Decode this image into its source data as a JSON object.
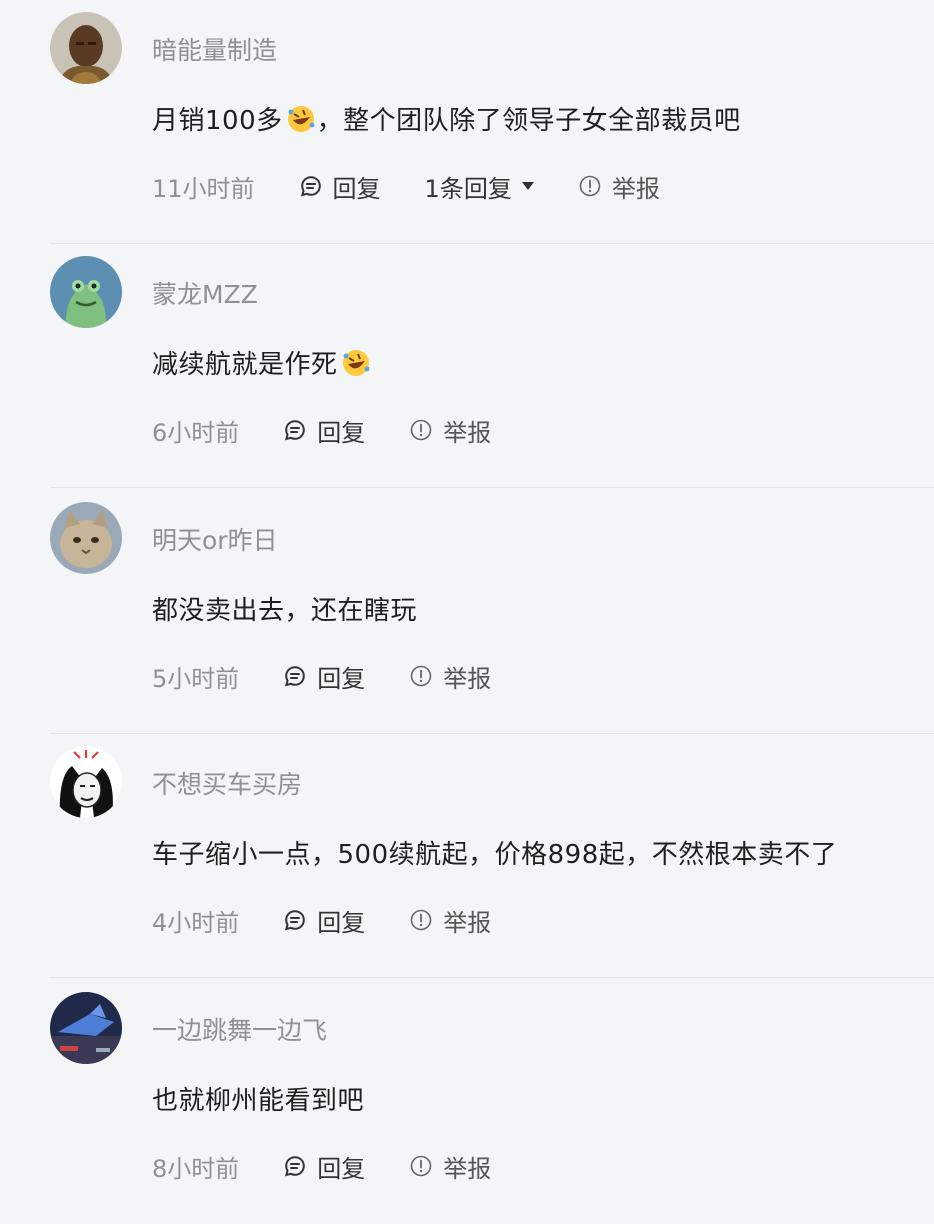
{
  "comments": [
    {
      "username": "暗能量制造",
      "content": "月销100多",
      "content_tail": "，整个团队除了领导子女全部裁员吧",
      "emoji": "rofl-emoji",
      "time": "11小时前",
      "reply_label": "回复",
      "replies_label": "1条回复",
      "report_label": "举报"
    },
    {
      "username": "蒙龙MZZ",
      "content": "减续航就是作死",
      "content_tail": "",
      "emoji": "rofl-emoji",
      "time": "6小时前",
      "reply_label": "回复",
      "report_label": "举报"
    },
    {
      "username": "明天or昨日",
      "content": "都没卖出去，还在瞎玩",
      "content_tail": "",
      "time": "5小时前",
      "reply_label": "回复",
      "report_label": "举报"
    },
    {
      "username": "不想买车买房",
      "content": "车子缩小一点，500续航起，价格898起，不然根本卖不了",
      "content_tail": "",
      "time": "4小时前",
      "reply_label": "回复",
      "report_label": "举报"
    },
    {
      "username": "一边跳舞一边飞",
      "content": "也就柳州能看到吧",
      "content_tail": "",
      "time": "8小时前",
      "reply_label": "回复",
      "report_label": "举报"
    }
  ],
  "icons": {
    "reply": "chat-bubble-icon",
    "report": "info-circle-icon",
    "expand": "caret-down-icon"
  },
  "colors": {
    "background": "#f4f5f7",
    "muted_text": "#8e9196",
    "body_text": "#1f1f1f",
    "divider": "#e3e4e8"
  }
}
